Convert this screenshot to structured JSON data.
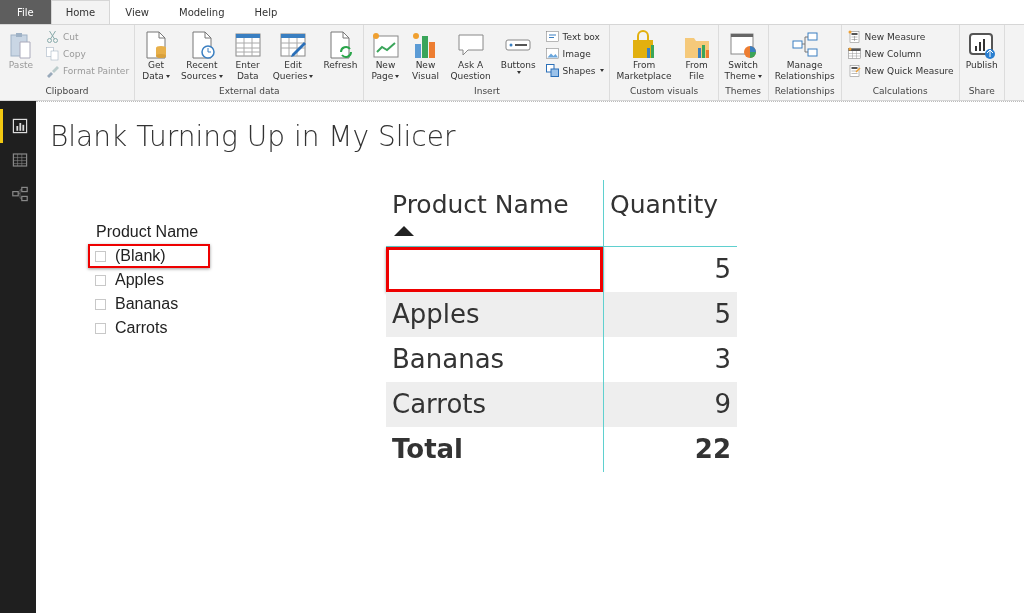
{
  "tabs": [
    {
      "label": "File",
      "kind": "file",
      "selected": false
    },
    {
      "label": "Home",
      "kind": "tab",
      "selected": true
    },
    {
      "label": "View",
      "kind": "tab",
      "selected": false
    },
    {
      "label": "Modeling",
      "kind": "tab",
      "selected": false
    },
    {
      "label": "Help",
      "kind": "tab",
      "selected": false
    }
  ],
  "ribbon": [
    {
      "label": "Clipboard",
      "items": [
        {
          "kind": "large",
          "label": "Paste",
          "dropdown": false,
          "disabled": true
        },
        {
          "kind": "small",
          "label": "Cut",
          "dropdown": false,
          "disabled": true
        },
        {
          "kind": "small",
          "label": "Copy",
          "dropdown": false,
          "disabled": true
        },
        {
          "kind": "small",
          "label": "Format Painter",
          "dropdown": false,
          "disabled": true
        }
      ]
    },
    {
      "label": "External data",
      "items": [
        {
          "kind": "large",
          "label": "Get\nData",
          "dropdown": true,
          "disabled": false
        },
        {
          "kind": "large",
          "label": "Recent\nSources",
          "dropdown": true,
          "disabled": false
        },
        {
          "kind": "large",
          "label": "Enter\nData",
          "dropdown": false,
          "disabled": false
        },
        {
          "kind": "large",
          "label": "Edit\nQueries",
          "dropdown": true,
          "disabled": false
        },
        {
          "kind": "large",
          "label": "Refresh",
          "dropdown": false,
          "disabled": false
        }
      ]
    },
    {
      "label": "Insert",
      "items": [
        {
          "kind": "large",
          "label": "New\nPage",
          "dropdown": true,
          "disabled": false
        },
        {
          "kind": "large",
          "label": "New\nVisual",
          "dropdown": false,
          "disabled": false
        },
        {
          "kind": "large",
          "label": "Ask A\nQuestion",
          "dropdown": false,
          "disabled": false
        },
        {
          "kind": "large",
          "label": "Buttons",
          "dropdown": true,
          "disabled": false
        },
        {
          "kind": "small",
          "label": "Text box",
          "dropdown": false,
          "disabled": false
        },
        {
          "kind": "small",
          "label": "Image",
          "dropdown": false,
          "disabled": false
        },
        {
          "kind": "small",
          "label": "Shapes",
          "dropdown": true,
          "disabled": false
        }
      ]
    },
    {
      "label": "Custom visuals",
      "items": [
        {
          "kind": "large",
          "label": "From\nMarketplace",
          "dropdown": false,
          "disabled": false
        },
        {
          "kind": "large",
          "label": "From\nFile",
          "dropdown": false,
          "disabled": false
        }
      ]
    },
    {
      "label": "Themes",
      "items": [
        {
          "kind": "large",
          "label": "Switch\nTheme",
          "dropdown": true,
          "disabled": false
        }
      ]
    },
    {
      "label": "Relationships",
      "items": [
        {
          "kind": "large",
          "label": "Manage\nRelationships",
          "dropdown": false,
          "disabled": false
        }
      ]
    },
    {
      "label": "Calculations",
      "items": [
        {
          "kind": "small",
          "label": "New Measure",
          "dropdown": false,
          "disabled": false
        },
        {
          "kind": "small",
          "label": "New Column",
          "dropdown": false,
          "disabled": false
        },
        {
          "kind": "small",
          "label": "New Quick Measure",
          "dropdown": false,
          "disabled": false
        }
      ]
    },
    {
      "label": "Share",
      "items": [
        {
          "kind": "large",
          "label": "Publish",
          "dropdown": false,
          "disabled": false
        }
      ]
    }
  ],
  "views": [
    {
      "selected": true
    },
    {
      "selected": false
    },
    {
      "selected": false
    }
  ],
  "page": {
    "title": "Blank Turning Up in My Slicer"
  },
  "slicer": {
    "title": "Product Name",
    "items": [
      {
        "label": "(Blank)",
        "checked": false,
        "highlighted": true
      },
      {
        "label": "Apples",
        "checked": false,
        "highlighted": false
      },
      {
        "label": "Bananas",
        "checked": false,
        "highlighted": false
      },
      {
        "label": "Carrots",
        "checked": false,
        "highlighted": false
      }
    ]
  },
  "table": {
    "columns": [
      {
        "label": "Product Name",
        "sorted": true
      },
      {
        "label": "Quantity",
        "sorted": false
      }
    ],
    "rows": [
      {
        "quantity": "5",
        "highlighted": true
      },
      {
        "product": "Apples",
        "quantity": "5",
        "highlighted": false
      },
      {
        "product": "Bananas",
        "quantity": "3",
        "highlighted": false
      },
      {
        "product": "Carrots",
        "quantity": "9",
        "highlighted": false
      }
    ],
    "total": {
      "label": "Total",
      "quantity": "22"
    }
  }
}
